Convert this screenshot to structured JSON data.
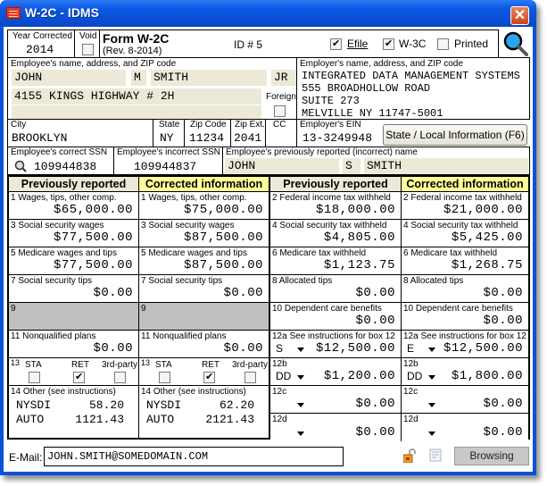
{
  "window": {
    "title": "W-2C - IDMS",
    "close_label": "✕"
  },
  "header": {
    "year_label": "Year Corrected",
    "year_value": "2014",
    "void_label": "Void",
    "void_checked": false,
    "form_title": "Form W-2C",
    "form_rev": "(Rev. 8-2014)",
    "id_label": "ID # 5",
    "efile_label": "Efile",
    "efile_checked": true,
    "w3c_label": "W-3C",
    "w3c_checked": true,
    "printed_label": "Printed",
    "printed_checked": false
  },
  "employee": {
    "section_label": "Employee's name, address, and ZIP code",
    "first": "JOHN",
    "middle": "M",
    "last": "SMITH",
    "suffix": "JR",
    "address1": "4155 KINGS HIGHWAY # 2H",
    "address2": "",
    "foreign_label": "Foreign",
    "foreign_checked": false,
    "city_label": "City",
    "city": "BROOKLYN",
    "state_label": "State",
    "state": "NY",
    "zip_label": "Zip Code",
    "zip": "11234",
    "zipext_label": "Zip Ext.",
    "zipext": "2041",
    "cc_label": "CC",
    "cc": ""
  },
  "employer": {
    "section_label": "Employer's name, address, and ZIP code",
    "lines": [
      "INTEGRATED DATA MANAGEMENT SYSTEMS",
      "555 BROADHOLLOW ROAD",
      "SUITE 273",
      "MELVILLE NY 11747-5001"
    ],
    "ein_label": "Employer's EIN",
    "ein": "13-3249948",
    "state_button": "State / Local Information (F6)"
  },
  "ssn": {
    "correct_label": "Employee's correct SSN",
    "correct": "109944838",
    "incorrect_label": "Employee's incorrect SSN",
    "incorrect": "109944837",
    "prev_name_label": "Employee's previously reported (incorrect) name",
    "prev_first": "JOHN",
    "prev_middle": "S",
    "prev_last": "SMITH"
  },
  "grid": {
    "prev_header": "Previously reported",
    "corr_header": "Corrected information",
    "left": [
      {
        "label": "1  Wages, tips, other comp.",
        "prev": "$65,000.00",
        "corr": "$75,000.00"
      },
      {
        "label": "3  Social security wages",
        "prev": "$77,500.00",
        "corr": "$87,500.00"
      },
      {
        "label": "5  Medicare wages and tips",
        "prev": "$77,500.00",
        "corr": "$87,500.00"
      },
      {
        "label": "7  Social security tips",
        "prev": "$0.00",
        "corr": "$0.00"
      },
      {
        "label": "9",
        "prev": "",
        "corr": ""
      },
      {
        "label": "11  Nonqualified plans",
        "prev": "$0.00",
        "corr": "$0.00"
      }
    ],
    "right": [
      {
        "label": "2  Federal income tax withheld",
        "prev": "$18,000.00",
        "corr": "$21,000.00"
      },
      {
        "label": "4  Social security tax withheld",
        "prev": "$4,805.00",
        "corr": "$5,425.00"
      },
      {
        "label": "6  Medicare tax withheld",
        "prev": "$1,123.75",
        "corr": "$1,268.75"
      },
      {
        "label": "8  Allocated tips",
        "prev": "$0.00",
        "corr": "$0.00"
      },
      {
        "label": "10  Dependent care benefits",
        "prev": "$0.00",
        "corr": "$0.00"
      }
    ],
    "box12": [
      {
        "label": "12a  See instructions for box 12",
        "prev_code": "S",
        "prev": "$12,500.00",
        "corr_code": "E",
        "corr": "$12,500.00"
      },
      {
        "label": "12b",
        "prev_code": "DD",
        "prev": "$1,200.00",
        "corr_code": "DD",
        "corr": "$1,800.00"
      },
      {
        "label": "12c",
        "prev_code": "",
        "prev": "$0.00",
        "corr_code": "",
        "corr": "$0.00"
      },
      {
        "label": "12d",
        "prev_code": "",
        "prev": "$0.00",
        "corr_code": "",
        "corr": "$0.00"
      }
    ],
    "box13": {
      "num": "13",
      "sta": "STA",
      "ret": "RET",
      "third": "3rd-party",
      "prev": {
        "sta": false,
        "ret": true,
        "third": false
      },
      "corr": {
        "sta": false,
        "ret": true,
        "third": false
      }
    },
    "box14": {
      "label": "14  Other (see instructions)",
      "prev": [
        {
          "code": "NYSDI",
          "amount": "58.20"
        },
        {
          "code": "AUTO",
          "amount": "1121.43"
        }
      ],
      "corr": [
        {
          "code": "NYSDI",
          "amount": "62.20"
        },
        {
          "code": "AUTO",
          "amount": "2121.43"
        }
      ]
    }
  },
  "footer": {
    "email_label": "E-Mail:",
    "email": "JOHN.SMITH@SOMEDOMAIN.COM",
    "browse_label": "Browsing"
  }
}
